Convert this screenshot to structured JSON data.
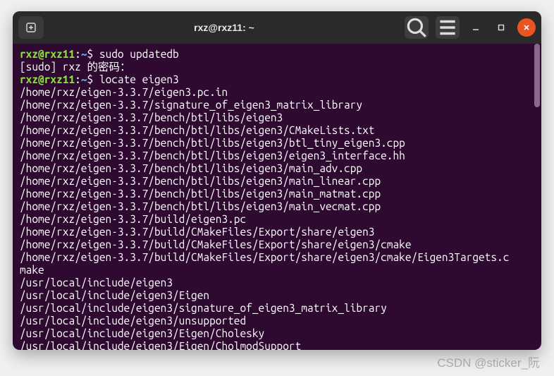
{
  "titlebar": {
    "title": "rxz@rxz11: ~"
  },
  "prompt": {
    "user": "rxz",
    "at": "@",
    "host": "rxz11",
    "colon": ":",
    "path": "~",
    "dollar": "$"
  },
  "lines": [
    {
      "type": "cmd",
      "text": "sudo updatedb"
    },
    {
      "type": "out",
      "text": "[sudo] rxz 的密码："
    },
    {
      "type": "cmd",
      "text": "locate eigen3"
    },
    {
      "type": "out",
      "text": "/home/rxz/eigen-3.3.7/eigen3.pc.in"
    },
    {
      "type": "out",
      "text": "/home/rxz/eigen-3.3.7/signature_of_eigen3_matrix_library"
    },
    {
      "type": "out",
      "text": "/home/rxz/eigen-3.3.7/bench/btl/libs/eigen3"
    },
    {
      "type": "out",
      "text": "/home/rxz/eigen-3.3.7/bench/btl/libs/eigen3/CMakeLists.txt"
    },
    {
      "type": "out",
      "text": "/home/rxz/eigen-3.3.7/bench/btl/libs/eigen3/btl_tiny_eigen3.cpp"
    },
    {
      "type": "out",
      "text": "/home/rxz/eigen-3.3.7/bench/btl/libs/eigen3/eigen3_interface.hh"
    },
    {
      "type": "out",
      "text": "/home/rxz/eigen-3.3.7/bench/btl/libs/eigen3/main_adv.cpp"
    },
    {
      "type": "out",
      "text": "/home/rxz/eigen-3.3.7/bench/btl/libs/eigen3/main_linear.cpp"
    },
    {
      "type": "out",
      "text": "/home/rxz/eigen-3.3.7/bench/btl/libs/eigen3/main_matmat.cpp"
    },
    {
      "type": "out",
      "text": "/home/rxz/eigen-3.3.7/bench/btl/libs/eigen3/main_vecmat.cpp"
    },
    {
      "type": "out",
      "text": "/home/rxz/eigen-3.3.7/build/eigen3.pc"
    },
    {
      "type": "out",
      "text": "/home/rxz/eigen-3.3.7/build/CMakeFiles/Export/share/eigen3"
    },
    {
      "type": "out",
      "text": "/home/rxz/eigen-3.3.7/build/CMakeFiles/Export/share/eigen3/cmake"
    },
    {
      "type": "out",
      "text": "/home/rxz/eigen-3.3.7/build/CMakeFiles/Export/share/eigen3/cmake/Eigen3Targets.c"
    },
    {
      "type": "out",
      "text": "make"
    },
    {
      "type": "out",
      "text": "/usr/local/include/eigen3"
    },
    {
      "type": "out",
      "text": "/usr/local/include/eigen3/Eigen"
    },
    {
      "type": "out",
      "text": "/usr/local/include/eigen3/signature_of_eigen3_matrix_library"
    },
    {
      "type": "out",
      "text": "/usr/local/include/eigen3/unsupported"
    },
    {
      "type": "out",
      "text": "/usr/local/include/eigen3/Eigen/Cholesky"
    },
    {
      "type": "out",
      "text": "/usr/local/include/eigen3/Eigen/CholmodSupport"
    }
  ],
  "watermark": "CSDN @sticker_阮"
}
